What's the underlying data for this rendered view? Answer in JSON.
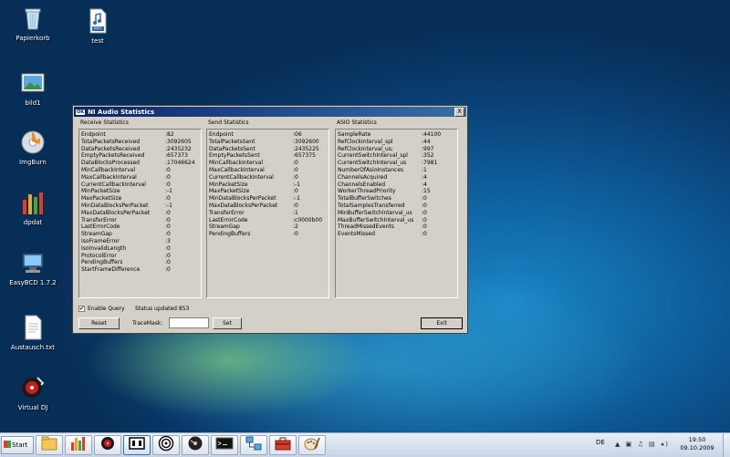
{
  "desktop": {
    "icons": [
      {
        "label": "Papierkorb",
        "icon": "recycle-bin-icon"
      },
      {
        "label": "test",
        "icon": "mp3-file-icon",
        "badge": "MP3"
      },
      {
        "label": "bild1",
        "icon": "image-file-icon"
      },
      {
        "label": "ImgBurn",
        "icon": "imgburn-icon"
      },
      {
        "label": "dpdat",
        "icon": "bar-chart-app-icon"
      },
      {
        "label": "EasyBCD 1.7.2",
        "icon": "easybcd-icon"
      },
      {
        "label": "Austausch.txt",
        "icon": "text-file-icon"
      },
      {
        "label": "Virtual DJ",
        "icon": "virtual-dj-icon"
      }
    ]
  },
  "window": {
    "logo": "OK",
    "title": "NI Audio Statistics",
    "close_label": "X",
    "receive": {
      "title": "Receive Statistics",
      "rows": [
        {
          "k": "Endpoint",
          "v": ":82"
        },
        {
          "k": "TotalPacketsReceived",
          "v": ":3092605"
        },
        {
          "k": "DataPacketsReceived",
          "v": ":2435232"
        },
        {
          "k": "EmptyPacketsReceived",
          "v": ":657373"
        },
        {
          "k": "DataBlocksProcessed",
          "v": ":17046624"
        },
        {
          "k": "MinCallbackInterval",
          "v": ":0"
        },
        {
          "k": "MaxCallbackInterval",
          "v": ":0"
        },
        {
          "k": "CurrentCallbackInterval",
          "v": ":0"
        },
        {
          "k": "MinPacketSize",
          "v": ":-1"
        },
        {
          "k": "MaxPacketSize",
          "v": ":0"
        },
        {
          "k": "MinDataBlocksPerPacket",
          "v": ":-1"
        },
        {
          "k": "MaxDataBlocksPerPacket",
          "v": ":0"
        },
        {
          "k": "TransferError",
          "v": ":0"
        },
        {
          "k": "LastErrorCode",
          "v": ":0"
        },
        {
          "k": "StreamGap",
          "v": ":0"
        },
        {
          "k": "IsoFrameError",
          "v": ":3"
        },
        {
          "k": "IsoInvalidLength",
          "v": ":0"
        },
        {
          "k": "ProtocolError",
          "v": ":0"
        },
        {
          "k": "PendingBuffers",
          "v": ":0"
        },
        {
          "k": "StartFrameDifference",
          "v": ":0"
        }
      ]
    },
    "send": {
      "title": "Send Statistics",
      "rows": [
        {
          "k": "Endpoint",
          "v": ":06"
        },
        {
          "k": "TotalPacketsSent",
          "v": ":3092600"
        },
        {
          "k": "DataPacketsSent",
          "v": ":2435225"
        },
        {
          "k": "EmptyPacketsSent",
          "v": ":657375"
        },
        {
          "k": "MinCallbackInterval",
          "v": ":0"
        },
        {
          "k": "MaxCallbackInterval",
          "v": ":0"
        },
        {
          "k": "CurrentCallbackInterval",
          "v": ":0"
        },
        {
          "k": "MinPacketSize",
          "v": ":-1"
        },
        {
          "k": "MaxPacketSize",
          "v": ":0"
        },
        {
          "k": "MinDataBlocksPerPacket",
          "v": ":-1"
        },
        {
          "k": "MaxDataBlocksPerPacket",
          "v": ":0"
        },
        {
          "k": "TransferError",
          "v": ":1"
        },
        {
          "k": "LastErrorCode",
          "v": ":c0000b00"
        },
        {
          "k": "StreamGap",
          "v": ":2"
        },
        {
          "k": "PendingBuffers",
          "v": ":0"
        }
      ]
    },
    "asio": {
      "title": "ASIO Statistics",
      "rows": [
        {
          "k": "SampleRate",
          "v": ":44100"
        },
        {
          "k": "RefClockInterval_spl",
          "v": ":44"
        },
        {
          "k": "RefClockInterval_us;",
          "v": ":997"
        },
        {
          "k": "CurrentSwitchInterval_spl",
          "v": ":352"
        },
        {
          "k": "CurrentSwitchInterval_us",
          "v": ":7981"
        },
        {
          "k": "NumberOfAsioInstances",
          "v": ":1"
        },
        {
          "k": "ChannelsAcquired",
          "v": ":4"
        },
        {
          "k": "ChannelsEnabled",
          "v": ":4"
        },
        {
          "k": "WorkerThreadPriority",
          "v": ":15"
        },
        {
          "k": "TotalBufferSwitches",
          "v": ":0"
        },
        {
          "k": "TotalSamplesTransferred",
          "v": ":0"
        },
        {
          "k": "MinBufferSwitchInterval_us",
          "v": ":0"
        },
        {
          "k": "MaxBufferSwitchInterval_us",
          "v": ":0"
        },
        {
          "k": "ThreadMissedEvents",
          "v": ":0"
        },
        {
          "k": "EventsMissed",
          "v": ":0"
        }
      ]
    },
    "enable_query_label": "Enable Query",
    "enable_query_checked": true,
    "check_mark": "✔",
    "status_text": "Status updated 853",
    "reset_label": "Reset",
    "tracemask_label": "TraceMask:",
    "tracemask_value": "",
    "set_label": "Set",
    "exit_label": "Exit"
  },
  "taskbar": {
    "start_label": "Start",
    "pinned": [
      "explorer-icon",
      "bar-chart-app-icon",
      "virtual-dj-icon",
      "ni-audio-statistics-icon",
      "speaker-icon",
      "dvd-burner-icon",
      "console-icon",
      "network-icon",
      "toolbox-icon",
      "paint-icon"
    ],
    "language": "DE",
    "tray_text": "▲ ▣ ♫ ▤ ◂)",
    "time": "19:50",
    "date": "09.10.2009"
  }
}
